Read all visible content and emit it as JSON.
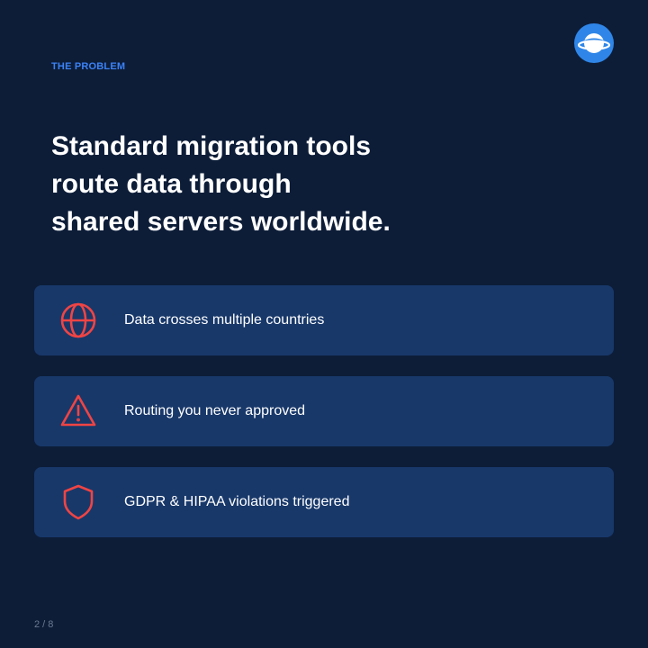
{
  "eyebrow": "THE PROBLEM",
  "headline": {
    "line1": "Standard migration tools",
    "line2": "route data through",
    "line3": "shared servers worldwide."
  },
  "cards": [
    {
      "icon": "globe-icon",
      "label": "Data crosses multiple countries"
    },
    {
      "icon": "warning-triangle-icon",
      "label": "Routing you never approved"
    },
    {
      "icon": "shield-icon",
      "label": "GDPR & HIPAA violations triggered"
    }
  ],
  "pager": "2 / 8",
  "colors": {
    "background": "#0d1d38",
    "card": "#18386a",
    "accent": "#3b82f6",
    "icon_red": "#ef4444",
    "text": "#ffffff",
    "muted": "#6b7a90"
  },
  "logo": {
    "icon": "planet-logo-icon"
  }
}
